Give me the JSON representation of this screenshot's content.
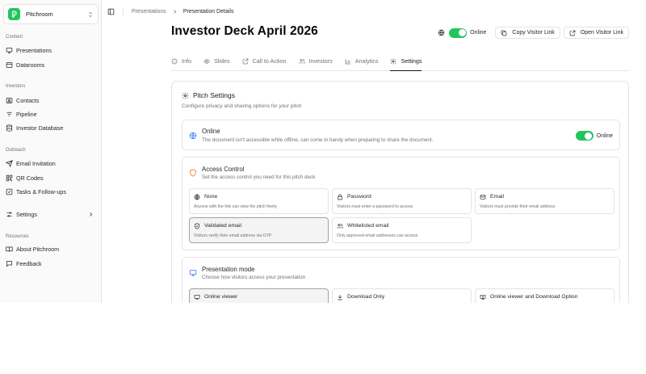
{
  "workspace": {
    "name": "Pitchroom"
  },
  "sidebar": {
    "groups": [
      {
        "label": "Content",
        "items": [
          "Presentations",
          "Datarooms"
        ]
      },
      {
        "label": "Investors",
        "items": [
          "Contacts",
          "Pipeline",
          "Investor Database"
        ]
      },
      {
        "label": "Outreach",
        "items": [
          "Email Invitation",
          "QR Codes",
          "Tasks & Follow-ups"
        ]
      },
      {
        "label": "Settings"
      },
      {
        "label": "Resources",
        "items": [
          "About Pitchroom",
          "Feedback"
        ]
      }
    ]
  },
  "breadcrumb": {
    "parent": "Presentations",
    "current": "Presentation Details"
  },
  "page": {
    "title": "Investor Deck April 2026"
  },
  "header_actions": {
    "online_label": "Online",
    "copy_link": "Copy Visitor Link",
    "open_link": "Open Visitor Link"
  },
  "tabs": [
    "Info",
    "Slides",
    "Call to Action",
    "Investors",
    "Analytics",
    "Settings"
  ],
  "active_tab": "Settings",
  "settings": {
    "title": "Pitch Settings",
    "subtitle": "Configure privacy and sharing options for your pitch",
    "online": {
      "title": "Online",
      "description": "The document isn't accessible while offline, can come in handy when preparing to share the document.",
      "toggle_label": "Online",
      "enabled": true
    },
    "access": {
      "title": "Access Control",
      "description": "Set the access control you need for this pitch deck",
      "options": [
        {
          "title": "None",
          "desc": "Anyone with the link can view the pitch freely"
        },
        {
          "title": "Password",
          "desc": "Visitors must enter a password to access"
        },
        {
          "title": "Email",
          "desc": "Visitors must provide their email address"
        },
        {
          "title": "Validated email",
          "desc": "Visitors verify their email address via OTP"
        },
        {
          "title": "Whitelisted email",
          "desc": "Only approved email addresses can access"
        }
      ],
      "selected": "Validated email"
    },
    "mode": {
      "title": "Presentation mode",
      "description": "Choose how visitors access your presentation",
      "options": [
        {
          "title": "Online viewer"
        },
        {
          "title": "Download Only"
        },
        {
          "title": "Online viewer and Download Option"
        }
      ],
      "selected": "Online viewer"
    }
  },
  "colors": {
    "accent_green": "#22c55e",
    "border": "#e4e4e7",
    "muted_text": "#71717a",
    "access_icon": "#f97316",
    "globe_icon": "#3b82f6"
  }
}
